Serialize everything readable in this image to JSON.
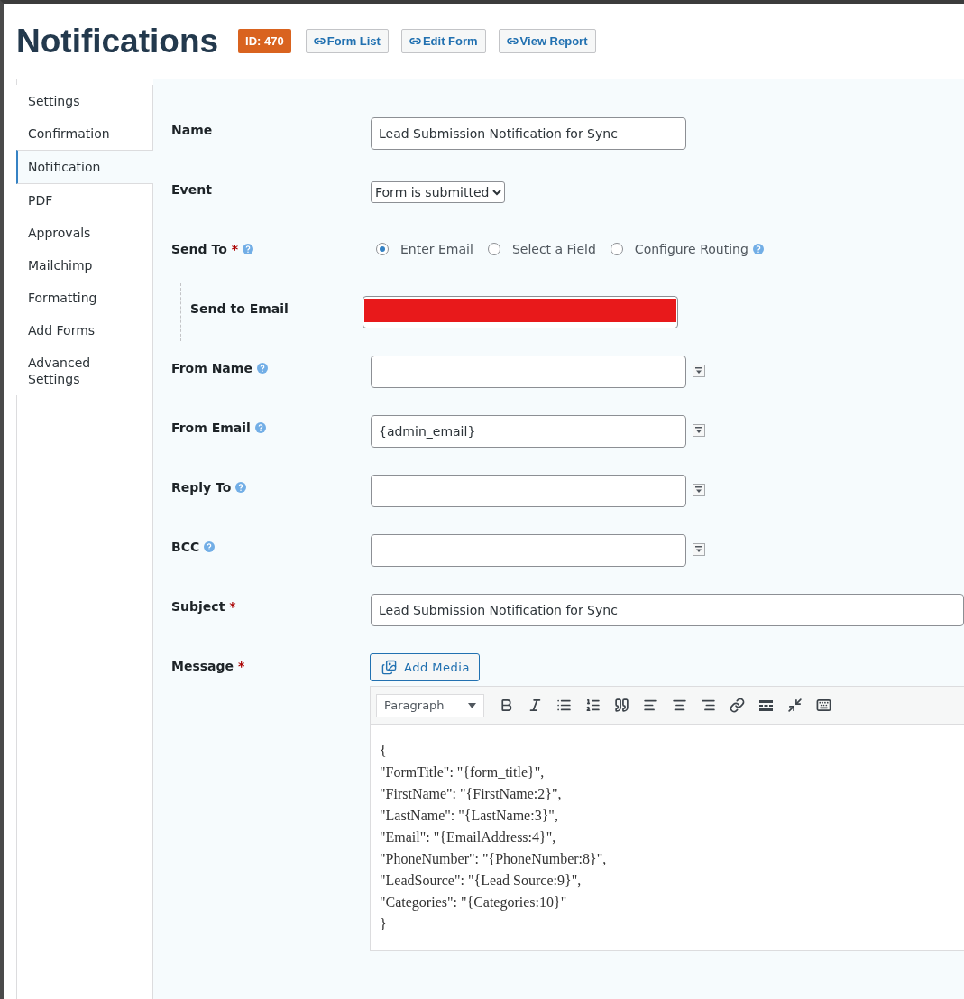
{
  "header": {
    "title": "Notifications",
    "badge": "ID: 470",
    "links": [
      {
        "label": "Form List"
      },
      {
        "label": "Edit Form"
      },
      {
        "label": "View Report"
      }
    ]
  },
  "sidebar": {
    "items": [
      {
        "label": "Settings",
        "selected": false
      },
      {
        "label": "Confirmation",
        "selected": false
      },
      {
        "label": "Notification",
        "selected": true
      },
      {
        "label": "PDF",
        "selected": false
      },
      {
        "label": "Approvals",
        "selected": false
      },
      {
        "label": "Mailchimp",
        "selected": false
      },
      {
        "label": "Formatting",
        "selected": false
      },
      {
        "label": "Add Forms",
        "selected": false
      },
      {
        "label": "Advanced Settings",
        "selected": false
      }
    ]
  },
  "fields": [
    {
      "kind": "text",
      "label": "Name",
      "value": "Lead Submission Notification for Sync"
    },
    {
      "kind": "select",
      "label": "Event",
      "value": "Form is submitted"
    },
    {
      "kind": "radio",
      "label": "Send To",
      "required_mark": "*",
      "help": true,
      "options": [
        {
          "label": "Enter Email",
          "selected": true
        },
        {
          "label": "Select a Field",
          "selected": false
        },
        {
          "label": "Configure Routing",
          "selected": false,
          "help": true
        }
      ]
    },
    {
      "kind": "redacted",
      "label": "Send to Email"
    },
    {
      "kind": "text",
      "label": "From Name",
      "help": true,
      "merge_tags": true
    },
    {
      "kind": "text",
      "label": "From Email",
      "help": true,
      "merge_tags": true,
      "value": "{admin_email}"
    },
    {
      "kind": "text",
      "label": "Reply To",
      "help": true,
      "merge_tags": true
    },
    {
      "kind": "text",
      "label": "BCC",
      "help": true,
      "merge_tags": true
    },
    {
      "kind": "text",
      "label": "Subject",
      "required_mark": "*",
      "wide": true,
      "value": "Lead Submission Notification for Sync"
    },
    {
      "kind": "editor",
      "label": "Message",
      "required_mark": "*",
      "media_button": "Add Media",
      "format": "Paragraph",
      "lines": [
        "{",
        "\"FormTitle\": \"{form_title}\",",
        "\"FirstName\": \"{FirstName:2}\",",
        "\"LastName\": \"{LastName:3}\",",
        "\"Email\": \"{EmailAddress:4}\",",
        "\"PhoneNumber\": \"{PhoneNumber:8}\",",
        "\"LeadSource\": \"{Lead Source:9}\",",
        "\"Categories\": \"{Categories:10}\"",
        "}"
      ]
    }
  ]
}
